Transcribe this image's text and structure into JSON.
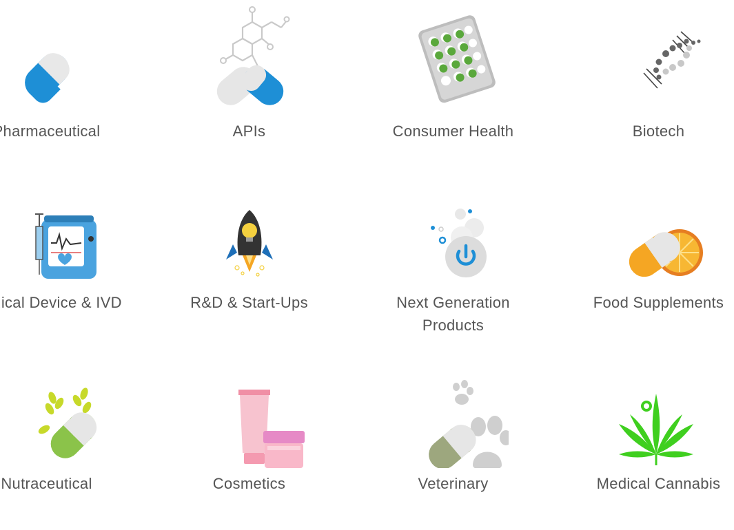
{
  "categories": [
    {
      "label": "Pharmaceutical",
      "icon": "capsule-icon"
    },
    {
      "label": "APIs",
      "icon": "molecule-capsule-icon"
    },
    {
      "label": "Consumer Health",
      "icon": "blister-pack-icon"
    },
    {
      "label": "Biotech",
      "icon": "dna-helix-icon"
    },
    {
      "label": "Medical Device & IVD",
      "icon": "heart-monitor-icon"
    },
    {
      "label": "R&D & Start-Ups",
      "icon": "rocket-icon"
    },
    {
      "label": "Next Generation Products",
      "icon": "power-bubbles-icon"
    },
    {
      "label": "Food Supplements",
      "icon": "capsule-orange-icon"
    },
    {
      "label": "Nutraceutical",
      "icon": "capsule-wheat-icon"
    },
    {
      "label": "Cosmetics",
      "icon": "cosmetic-tube-jar-icon"
    },
    {
      "label": "Veterinary",
      "icon": "capsule-paw-icon"
    },
    {
      "label": "Medical Cannabis",
      "icon": "cannabis-leaf-icon"
    }
  ],
  "colors": {
    "label_text": "#555555",
    "capsule_blue": "#1e8fd6",
    "capsule_white": "#e6e6e6",
    "pill_green": "#5aa83c",
    "orange": "#f39c12",
    "cannabis_green": "#3fcf1f",
    "cosmetic_pink": "#f6b8c4"
  }
}
